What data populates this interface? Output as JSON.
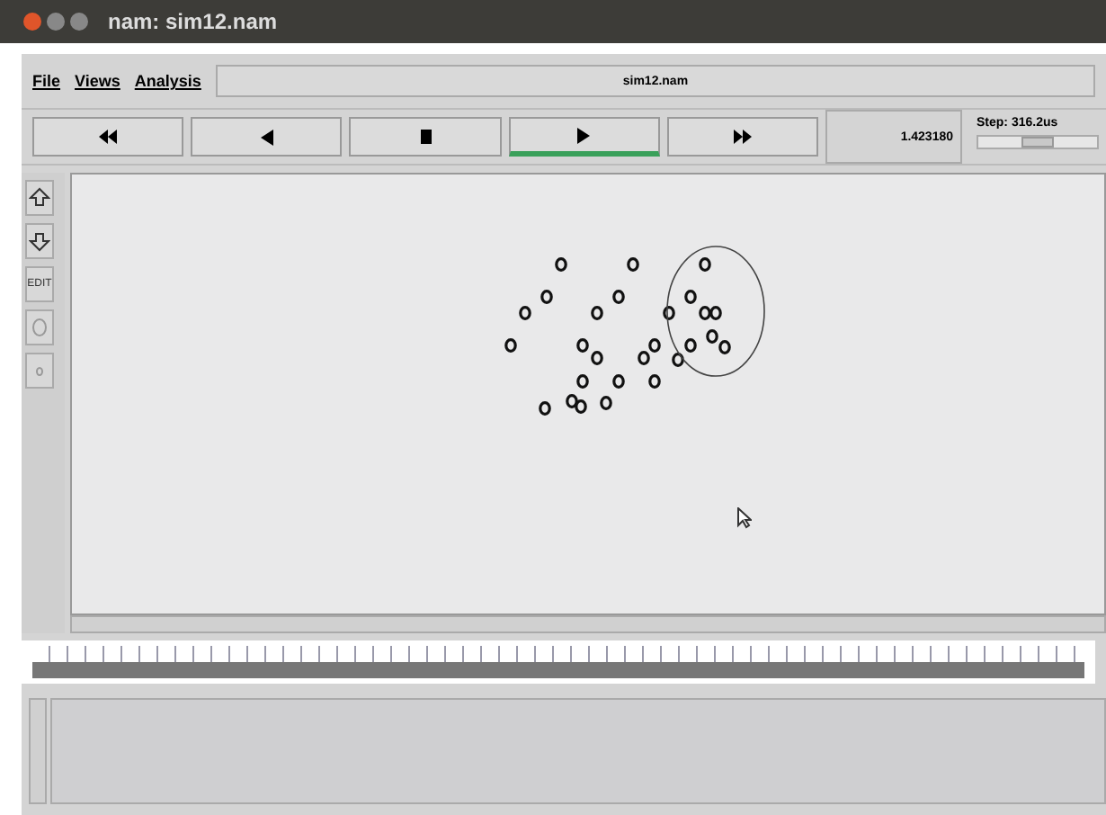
{
  "window": {
    "title": "nam: sim12.nam"
  },
  "menu": [
    {
      "label": "File"
    },
    {
      "label": "Views"
    },
    {
      "label": "Analysis"
    }
  ],
  "file_name": "sim12.nam",
  "transport": [
    {
      "kind": "rewind",
      "selected": false
    },
    {
      "kind": "back",
      "selected": false
    },
    {
      "kind": "stop",
      "selected": false
    },
    {
      "kind": "play",
      "selected": true
    },
    {
      "kind": "forward",
      "selected": false
    }
  ],
  "time": "1.423180",
  "step": {
    "label": "Step: 316.2us",
    "level": 0.5
  },
  "tools": [
    {
      "kind": "zoom-in"
    },
    {
      "kind": "zoom-out"
    },
    {
      "kind": "edit",
      "label": "EDIT"
    },
    {
      "kind": "circle"
    },
    {
      "kind": "dot"
    }
  ]
}
